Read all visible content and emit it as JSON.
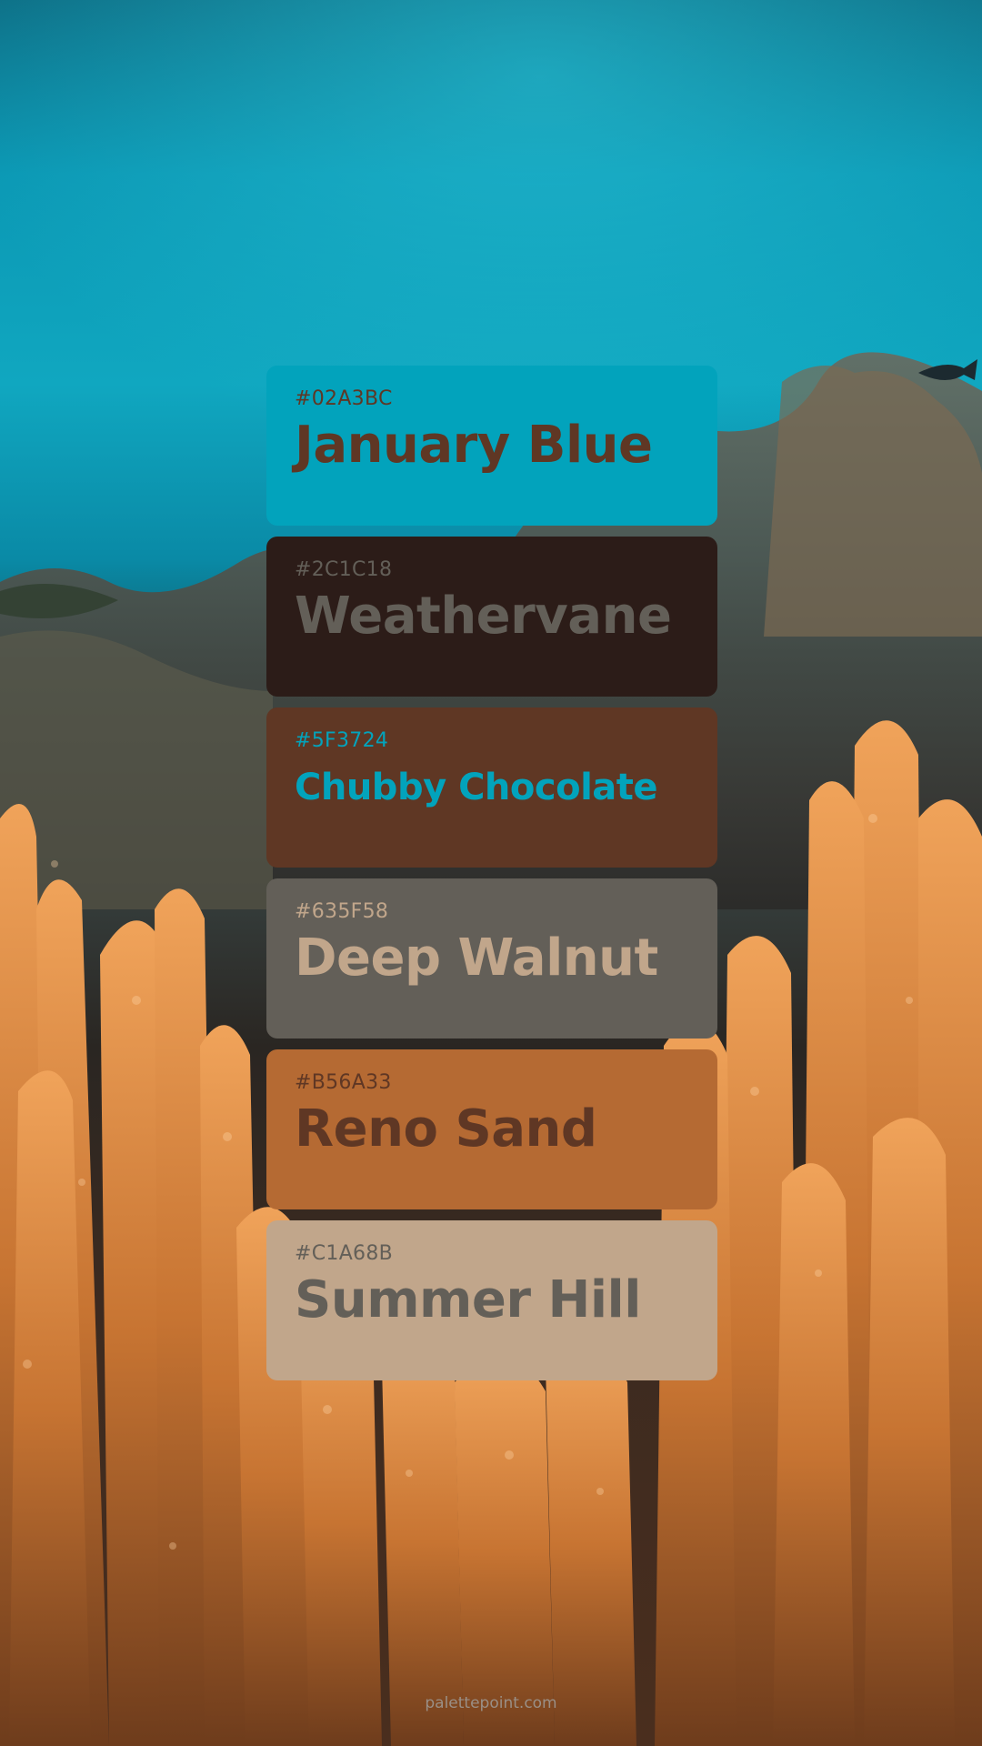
{
  "palette": [
    {
      "hex": "#02A3BC",
      "name": "January Blue",
      "bg": "#02A3BC",
      "text": "#5F3724"
    },
    {
      "hex": "#2C1C18",
      "name": "Weathervane",
      "bg": "#2C1C18",
      "text": "#635F58"
    },
    {
      "hex": "#5F3724",
      "name": "Chubby Chocolate",
      "bg": "#5F3724",
      "text": "#02A3BC"
    },
    {
      "hex": "#635F58",
      "name": "Deep Walnut",
      "bg": "#635F58",
      "text": "#C1A68B"
    },
    {
      "hex": "#B56A33",
      "name": "Reno Sand",
      "bg": "#B56A33",
      "text": "#5F3724"
    },
    {
      "hex": "#C1A68B",
      "name": "Summer Hill",
      "bg": "#C1A68B",
      "text": "#635F58"
    }
  ],
  "footer": {
    "text": "palettepoint.com"
  }
}
